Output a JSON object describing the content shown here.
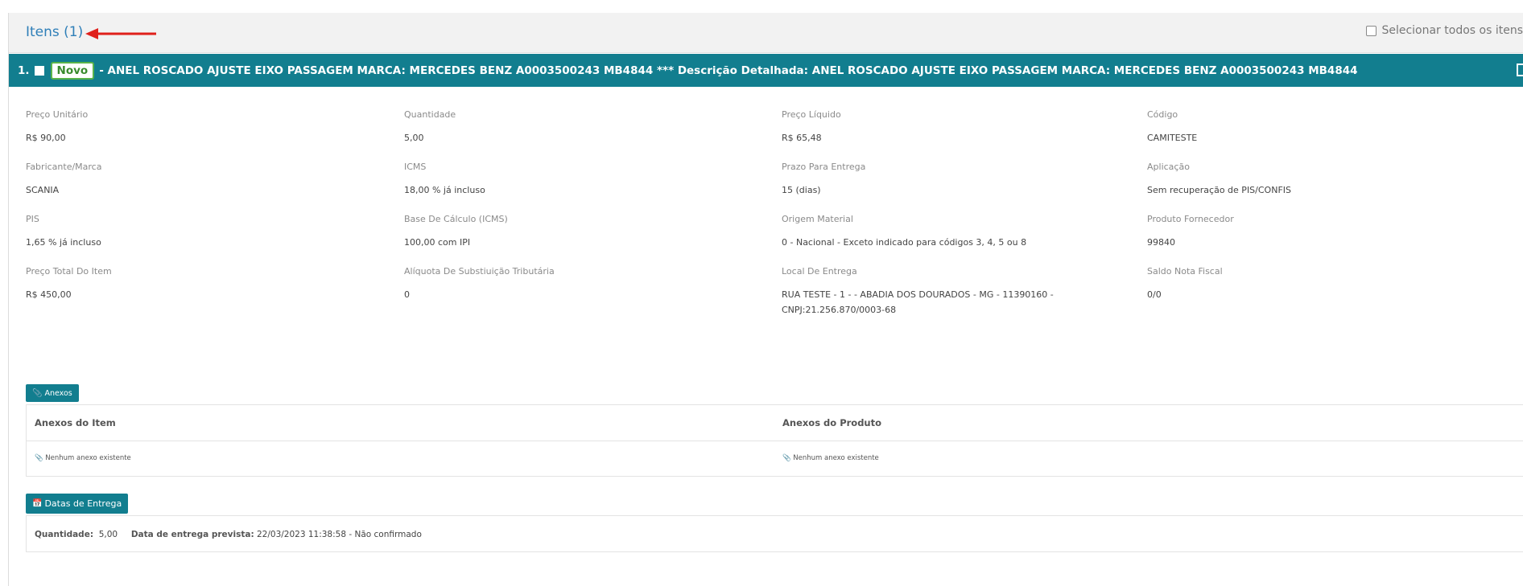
{
  "header": {
    "title": "Itens (1)",
    "select_all_label": "Selecionar todos os itens"
  },
  "item": {
    "number": "1.",
    "badge": "Novo",
    "title": "- ANEL ROSCADO AJUSTE EIXO PASSAGEM MARCA: MERCEDES BENZ A0003500243 MB4844 *** Descrição Detalhada: ANEL ROSCADO AJUSTE EIXO PASSAGEM MARCA: MERCEDES BENZ A0003500243 MB4844",
    "fields": {
      "preco_unitario": {
        "label": "Preço Unitário",
        "value": "R$ 90,00"
      },
      "quantidade": {
        "label": "Quantidade",
        "value": "5,00"
      },
      "preco_liquido": {
        "label": "Preço Líquido",
        "value": "R$ 65,48"
      },
      "codigo": {
        "label": "Código",
        "value": "CAMITESTE"
      },
      "fabricante": {
        "label": "Fabricante/Marca",
        "value": "SCANIA"
      },
      "icms": {
        "label": "ICMS",
        "value": "18,00 % já incluso"
      },
      "prazo": {
        "label": "Prazo Para Entrega",
        "value": "15 (dias)"
      },
      "aplicacao": {
        "label": "Aplicação",
        "value": "Sem recuperação de PIS/CONFIS"
      },
      "pis": {
        "label": "PIS",
        "value": "1,65 % já incluso"
      },
      "base_calculo": {
        "label": "Base De Cálculo (ICMS)",
        "value": "100,00 com IPI"
      },
      "origem": {
        "label": "Origem Material",
        "value": "0 - Nacional - Exceto indicado para códigos 3, 4, 5 ou 8"
      },
      "produto_fornecedor": {
        "label": "Produto Fornecedor",
        "value": "99840"
      },
      "preco_total": {
        "label": "Preço Total Do Item",
        "value": "R$ 450,00"
      },
      "aliquota_st": {
        "label": "Alíquota De Substiuição Tributária",
        "value": "0"
      },
      "local_entrega": {
        "label": "Local De Entrega",
        "value_line1": "RUA TESTE - 1 - - ABADIA DOS DOURADOS - MG - 11390160 -",
        "value_line2": "CNPJ:21.256.870/0003-68"
      },
      "saldo_nf": {
        "label": "Saldo Nota Fiscal",
        "value": "0/0"
      }
    }
  },
  "anexos": {
    "button_label": "Anexos",
    "col_item": "Anexos do Item",
    "col_produto": "Anexos do Produto",
    "item_empty": "Nenhum anexo existente",
    "produto_empty": "Nenhum anexo existente"
  },
  "datas": {
    "button_label": "Datas de Entrega",
    "qty_label": "Quantidade:",
    "qty_value": "5,00",
    "date_label": "Data de entrega prevista:",
    "date_value": "22/03/2023 11:38:58 - Não confirmado"
  },
  "colors": {
    "teal": "#127e8f",
    "link_blue": "#2f7fb8",
    "badge_green": "#59b34a",
    "arrow_red": "#e0201b"
  },
  "icons": {
    "anexos": "paperclip-icon",
    "datas": "calendar-icon",
    "annotation": "red-arrow-icon"
  }
}
